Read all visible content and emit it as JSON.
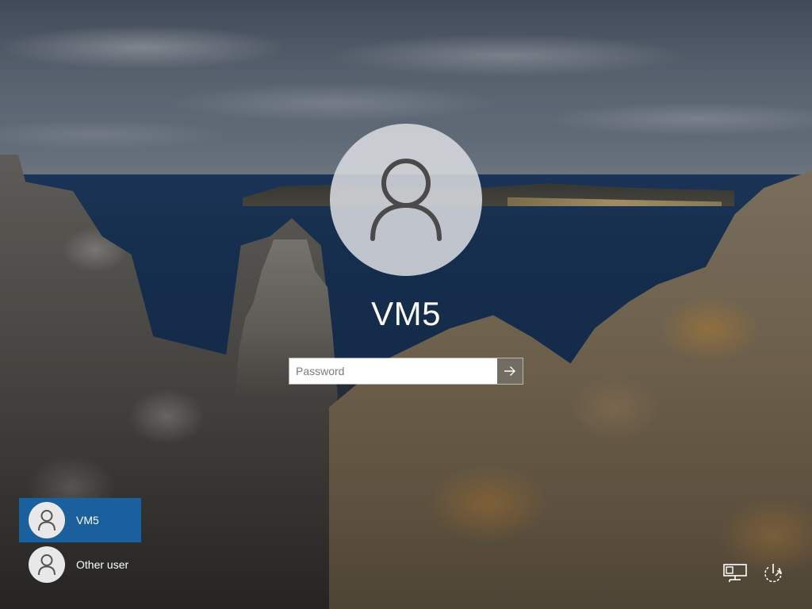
{
  "login": {
    "username": "VM5",
    "password_placeholder": "Password",
    "avatar_icon": "user-icon",
    "submit_icon": "arrow-right-icon"
  },
  "user_list": [
    {
      "label": "VM5",
      "selected": true,
      "icon": "user-icon"
    },
    {
      "label": "Other user",
      "selected": false,
      "icon": "user-icon"
    }
  ],
  "system_icons": {
    "network": "network-icon",
    "power": "power-icon"
  },
  "colors": {
    "selected_user_bg": "#1a5f9e",
    "avatar_bg": "#d7dade",
    "text": "#ffffff"
  }
}
